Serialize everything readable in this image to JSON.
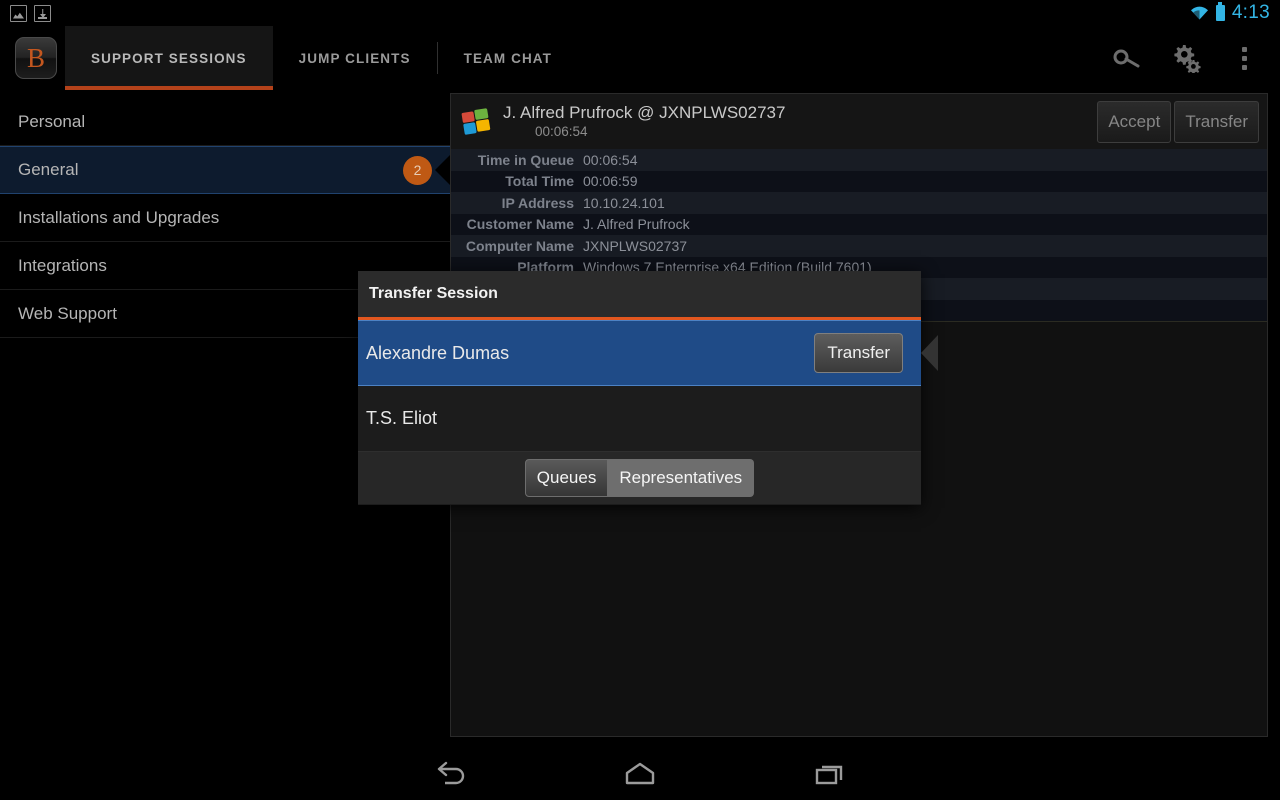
{
  "status_bar": {
    "notifications": [
      "screenshot-icon",
      "download-icon"
    ],
    "wifi_icon": "wifi-icon",
    "battery_icon": "battery-icon",
    "clock": "4:13",
    "accent_color": "#33b5e5"
  },
  "action_bar": {
    "logo_letter": "B",
    "tabs": [
      {
        "label": "SUPPORT SESSIONS",
        "active": true
      },
      {
        "label": "JUMP CLIENTS",
        "active": false
      },
      {
        "label": "TEAM CHAT",
        "active": false
      }
    ],
    "icons": [
      "key-icon",
      "gears-icon",
      "overflow-menu-icon"
    ],
    "active_tab_underline_color": "#b4421a"
  },
  "queues": {
    "items": [
      {
        "label": "Personal",
        "badge": "",
        "selected": false
      },
      {
        "label": "General",
        "badge": "2",
        "selected": true
      },
      {
        "label": "Installations and Upgrades",
        "badge": "",
        "selected": false
      },
      {
        "label": "Integrations",
        "badge": "",
        "selected": false
      },
      {
        "label": "Web Support",
        "badge": "",
        "selected": false
      }
    ],
    "badge_color": "#bf5914",
    "selected_bg": "#0d1b2e"
  },
  "session": {
    "platform_icon": "windows-logo-icon",
    "title": "J. Alfred Prufrock @ JXNPLWS02737",
    "elapsed": "00:06:54",
    "accept_label": "Accept",
    "transfer_label": "Transfer",
    "details": [
      {
        "label": "Time in Queue",
        "value": "00:06:54"
      },
      {
        "label": "Total Time",
        "value": "00:06:59"
      },
      {
        "label": "IP Address",
        "value": "10.10.24.101"
      },
      {
        "label": "Customer Name",
        "value": "J. Alfred Prufrock"
      },
      {
        "label": "Computer Name",
        "value": "JXNPLWS02737"
      },
      {
        "label": "Platform",
        "value": "Windows 7 Enterprise x64 Edition (Build 7601)"
      }
    ]
  },
  "dialog": {
    "title": "Transfer Session",
    "rule_color": "#e2571f",
    "representatives": [
      {
        "name": "Alexandre Dumas",
        "selected": true,
        "action_label": "Transfer"
      },
      {
        "name": "T.S. Eliot",
        "selected": false,
        "action_label": ""
      }
    ],
    "footer_segments": [
      {
        "label": "Queues",
        "selected": false
      },
      {
        "label": "Representatives",
        "selected": true
      }
    ]
  },
  "nav_bar": {
    "buttons": [
      "back-icon",
      "home-icon",
      "recents-icon"
    ]
  }
}
